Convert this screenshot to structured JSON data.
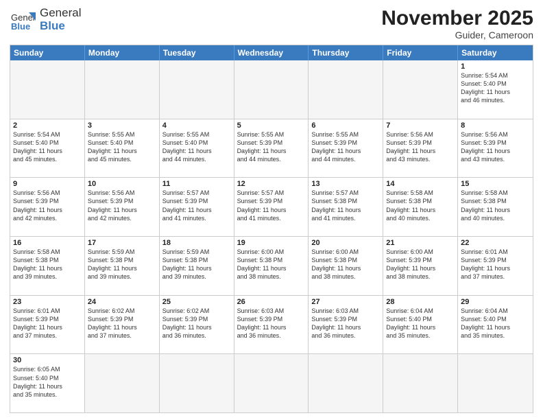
{
  "header": {
    "logo_general": "General",
    "logo_blue": "Blue",
    "month_year": "November 2025",
    "location": "Guider, Cameroon"
  },
  "weekdays": [
    "Sunday",
    "Monday",
    "Tuesday",
    "Wednesday",
    "Thursday",
    "Friday",
    "Saturday"
  ],
  "rows": [
    [
      {
        "day": "",
        "info": ""
      },
      {
        "day": "",
        "info": ""
      },
      {
        "day": "",
        "info": ""
      },
      {
        "day": "",
        "info": ""
      },
      {
        "day": "",
        "info": ""
      },
      {
        "day": "",
        "info": ""
      },
      {
        "day": "1",
        "info": "Sunrise: 5:54 AM\nSunset: 5:40 PM\nDaylight: 11 hours\nand 46 minutes."
      }
    ],
    [
      {
        "day": "2",
        "info": "Sunrise: 5:54 AM\nSunset: 5:40 PM\nDaylight: 11 hours\nand 45 minutes."
      },
      {
        "day": "3",
        "info": "Sunrise: 5:55 AM\nSunset: 5:40 PM\nDaylight: 11 hours\nand 45 minutes."
      },
      {
        "day": "4",
        "info": "Sunrise: 5:55 AM\nSunset: 5:40 PM\nDaylight: 11 hours\nand 44 minutes."
      },
      {
        "day": "5",
        "info": "Sunrise: 5:55 AM\nSunset: 5:39 PM\nDaylight: 11 hours\nand 44 minutes."
      },
      {
        "day": "6",
        "info": "Sunrise: 5:55 AM\nSunset: 5:39 PM\nDaylight: 11 hours\nand 44 minutes."
      },
      {
        "day": "7",
        "info": "Sunrise: 5:56 AM\nSunset: 5:39 PM\nDaylight: 11 hours\nand 43 minutes."
      },
      {
        "day": "8",
        "info": "Sunrise: 5:56 AM\nSunset: 5:39 PM\nDaylight: 11 hours\nand 43 minutes."
      }
    ],
    [
      {
        "day": "9",
        "info": "Sunrise: 5:56 AM\nSunset: 5:39 PM\nDaylight: 11 hours\nand 42 minutes."
      },
      {
        "day": "10",
        "info": "Sunrise: 5:56 AM\nSunset: 5:39 PM\nDaylight: 11 hours\nand 42 minutes."
      },
      {
        "day": "11",
        "info": "Sunrise: 5:57 AM\nSunset: 5:39 PM\nDaylight: 11 hours\nand 41 minutes."
      },
      {
        "day": "12",
        "info": "Sunrise: 5:57 AM\nSunset: 5:39 PM\nDaylight: 11 hours\nand 41 minutes."
      },
      {
        "day": "13",
        "info": "Sunrise: 5:57 AM\nSunset: 5:38 PM\nDaylight: 11 hours\nand 41 minutes."
      },
      {
        "day": "14",
        "info": "Sunrise: 5:58 AM\nSunset: 5:38 PM\nDaylight: 11 hours\nand 40 minutes."
      },
      {
        "day": "15",
        "info": "Sunrise: 5:58 AM\nSunset: 5:38 PM\nDaylight: 11 hours\nand 40 minutes."
      }
    ],
    [
      {
        "day": "16",
        "info": "Sunrise: 5:58 AM\nSunset: 5:38 PM\nDaylight: 11 hours\nand 39 minutes."
      },
      {
        "day": "17",
        "info": "Sunrise: 5:59 AM\nSunset: 5:38 PM\nDaylight: 11 hours\nand 39 minutes."
      },
      {
        "day": "18",
        "info": "Sunrise: 5:59 AM\nSunset: 5:38 PM\nDaylight: 11 hours\nand 39 minutes."
      },
      {
        "day": "19",
        "info": "Sunrise: 6:00 AM\nSunset: 5:38 PM\nDaylight: 11 hours\nand 38 minutes."
      },
      {
        "day": "20",
        "info": "Sunrise: 6:00 AM\nSunset: 5:38 PM\nDaylight: 11 hours\nand 38 minutes."
      },
      {
        "day": "21",
        "info": "Sunrise: 6:00 AM\nSunset: 5:39 PM\nDaylight: 11 hours\nand 38 minutes."
      },
      {
        "day": "22",
        "info": "Sunrise: 6:01 AM\nSunset: 5:39 PM\nDaylight: 11 hours\nand 37 minutes."
      }
    ],
    [
      {
        "day": "23",
        "info": "Sunrise: 6:01 AM\nSunset: 5:39 PM\nDaylight: 11 hours\nand 37 minutes."
      },
      {
        "day": "24",
        "info": "Sunrise: 6:02 AM\nSunset: 5:39 PM\nDaylight: 11 hours\nand 37 minutes."
      },
      {
        "day": "25",
        "info": "Sunrise: 6:02 AM\nSunset: 5:39 PM\nDaylight: 11 hours\nand 36 minutes."
      },
      {
        "day": "26",
        "info": "Sunrise: 6:03 AM\nSunset: 5:39 PM\nDaylight: 11 hours\nand 36 minutes."
      },
      {
        "day": "27",
        "info": "Sunrise: 6:03 AM\nSunset: 5:39 PM\nDaylight: 11 hours\nand 36 minutes."
      },
      {
        "day": "28",
        "info": "Sunrise: 6:04 AM\nSunset: 5:40 PM\nDaylight: 11 hours\nand 35 minutes."
      },
      {
        "day": "29",
        "info": "Sunrise: 6:04 AM\nSunset: 5:40 PM\nDaylight: 11 hours\nand 35 minutes."
      }
    ],
    [
      {
        "day": "30",
        "info": "Sunrise: 6:05 AM\nSunset: 5:40 PM\nDaylight: 11 hours\nand 35 minutes."
      },
      {
        "day": "",
        "info": ""
      },
      {
        "day": "",
        "info": ""
      },
      {
        "day": "",
        "info": ""
      },
      {
        "day": "",
        "info": ""
      },
      {
        "day": "",
        "info": ""
      },
      {
        "day": "",
        "info": ""
      }
    ]
  ]
}
